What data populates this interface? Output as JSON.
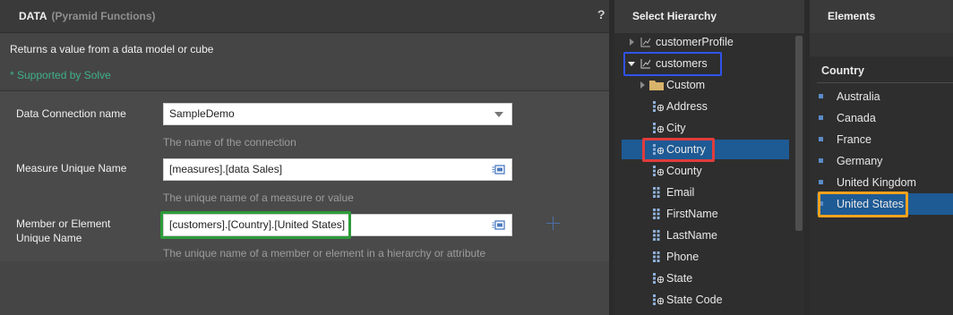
{
  "data_panel": {
    "title": "DATA",
    "subtitle": "(Pyramid Functions)",
    "help": "?",
    "description": "Returns a value from a data model or cube",
    "supported": "* Supported by Solve",
    "params": [
      {
        "label": "Data Connection name",
        "value": "SampleDemo",
        "hint": "The name of the connection"
      },
      {
        "label": "Measure Unique Name",
        "value": "[measures].[data Sales]",
        "hint": "The unique name of a measure or value"
      },
      {
        "label": "Member or Element Unique Name",
        "value": "[customers].[Country].[United States]",
        "hint": "The unique name of a member or element in a hierarchy or attribute"
      }
    ]
  },
  "hierarchy": {
    "title": "Select Hierarchy",
    "items": [
      {
        "label": "customerProfile",
        "icon": "hierarchy-icon",
        "state": "collapsed"
      },
      {
        "label": "customers",
        "icon": "hierarchy-icon",
        "state": "expanded"
      },
      {
        "label": "Custom",
        "icon": "folder-icon",
        "state": "collapsed"
      },
      {
        "label": "Address",
        "icon": "geo-attribute-icon"
      },
      {
        "label": "City",
        "icon": "geo-attribute-icon"
      },
      {
        "label": "Country",
        "icon": "geo-attribute-icon",
        "selected": true
      },
      {
        "label": "County",
        "icon": "geo-attribute-icon"
      },
      {
        "label": "Email",
        "icon": "attribute-icon"
      },
      {
        "label": "FirstName",
        "icon": "attribute-icon"
      },
      {
        "label": "LastName",
        "icon": "attribute-icon"
      },
      {
        "label": "Phone",
        "icon": "attribute-icon"
      },
      {
        "label": "State",
        "icon": "geo-attribute-icon"
      },
      {
        "label": "State Code",
        "icon": "geo-attribute-icon"
      }
    ]
  },
  "elements": {
    "title": "Elements",
    "group": "Country",
    "items": [
      "Australia",
      "Canada",
      "France",
      "Germany",
      "United Kingdom",
      "United States"
    ],
    "selected": "United States"
  },
  "colors": {
    "accent_selection": "#1e5a94",
    "highlight_blue": "#2f54ec",
    "highlight_red": "#e03c3c",
    "highlight_green": "#2d9c3a",
    "highlight_orange": "#f0a21e",
    "supported_text": "#3fb18a"
  }
}
